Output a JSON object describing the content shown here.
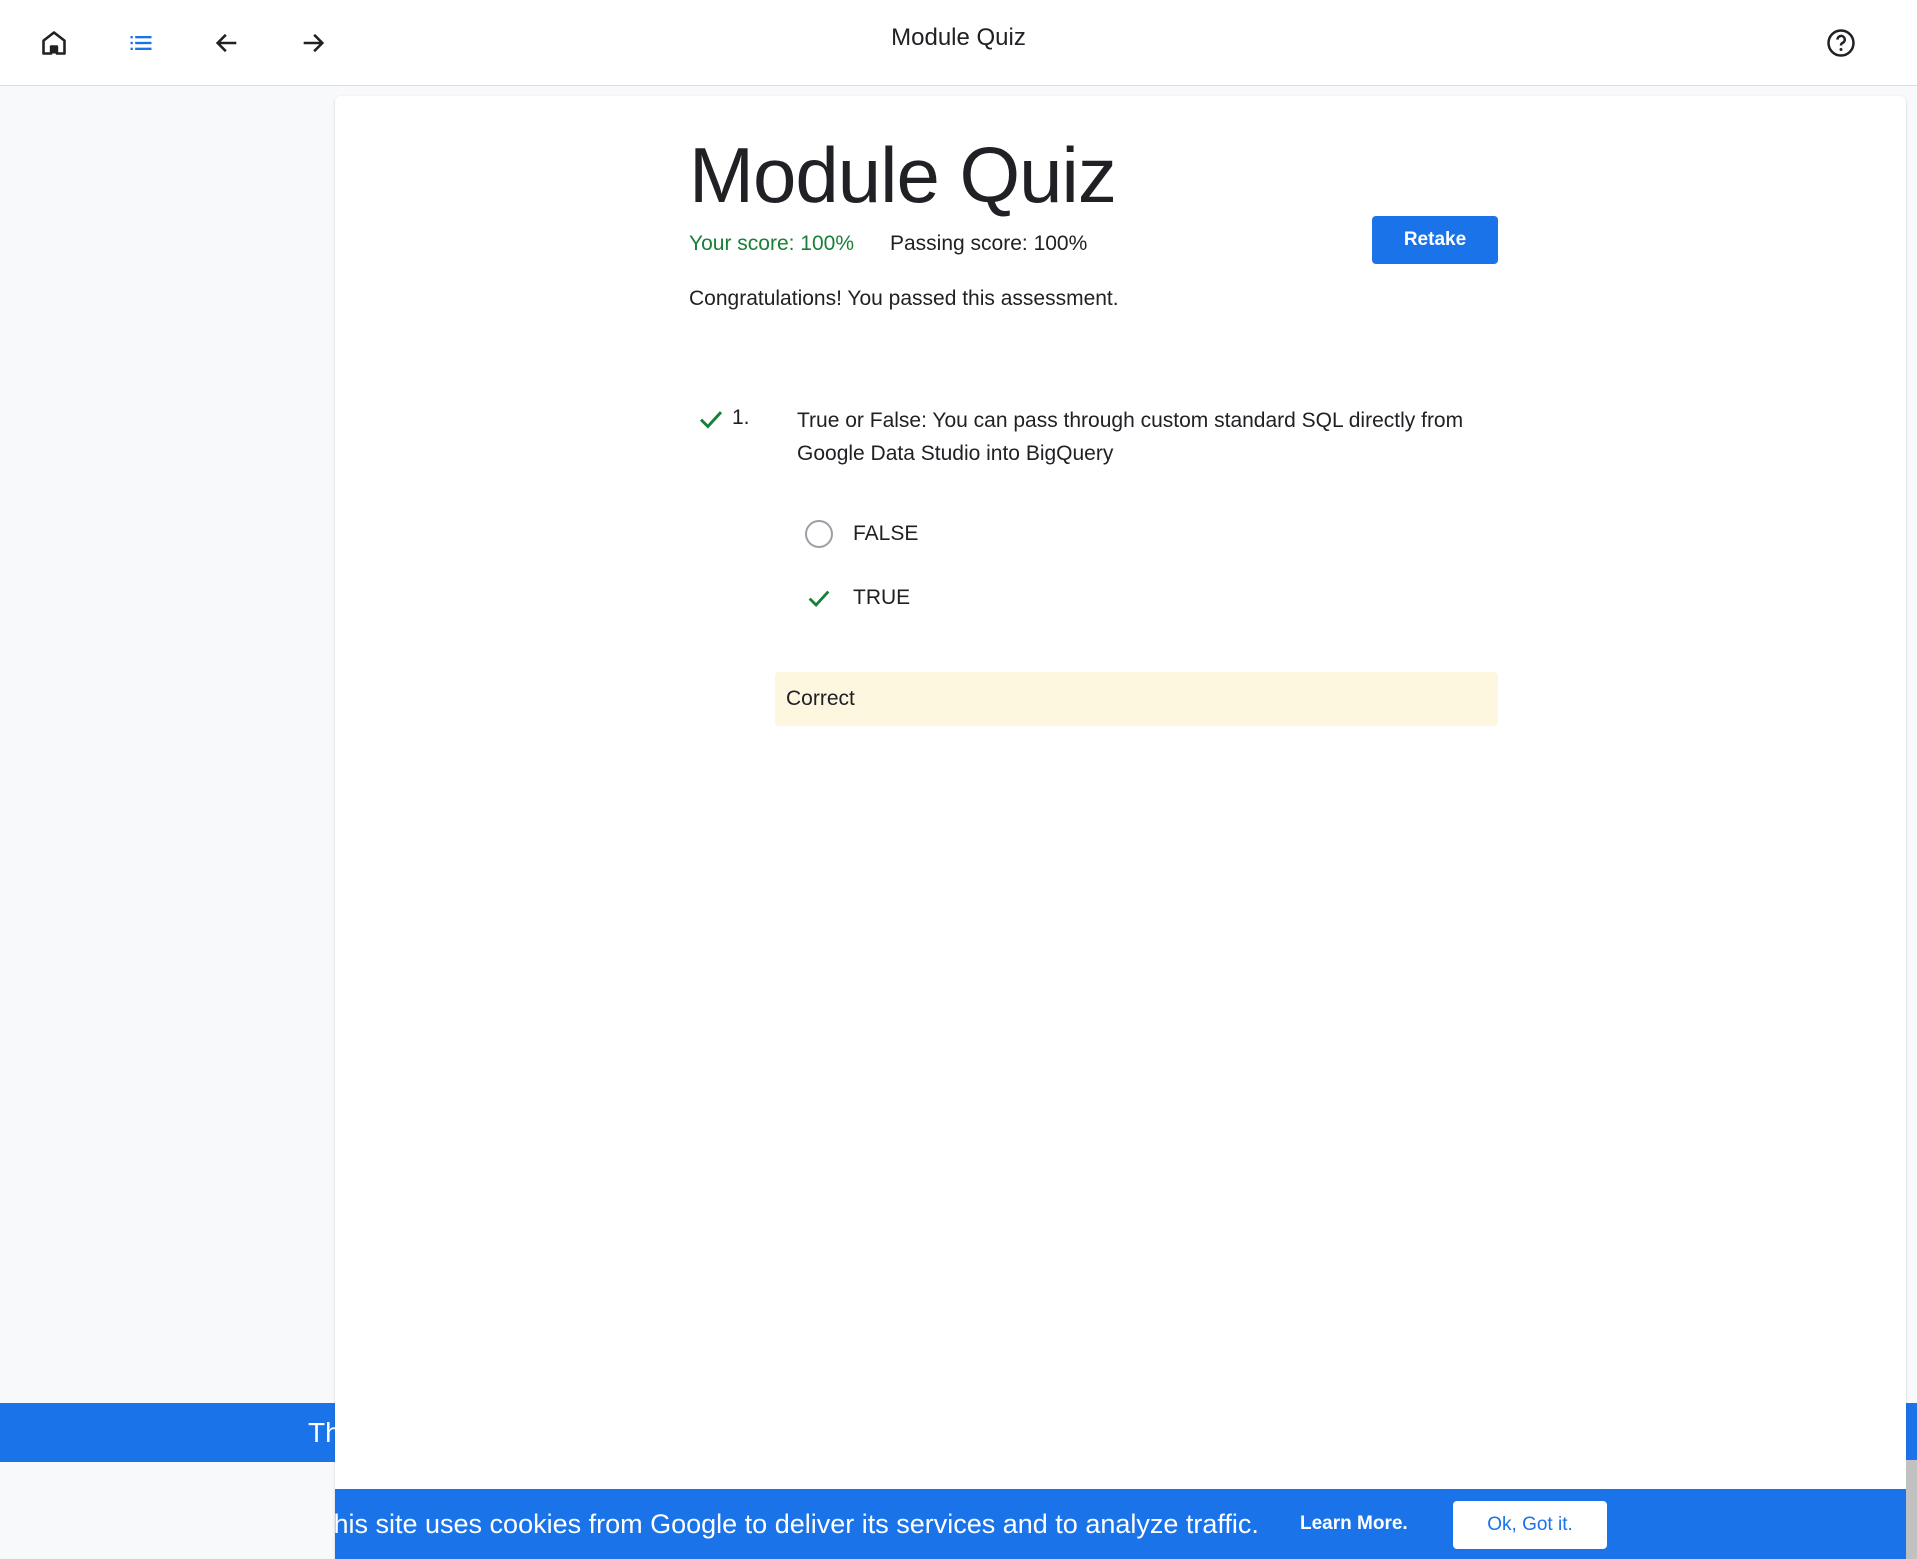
{
  "topbar": {
    "title": "Module Quiz",
    "icons": [
      "home-icon",
      "list-icon",
      "arrow-back-icon",
      "arrow-forward-icon",
      "help-icon"
    ]
  },
  "quiz": {
    "title": "Module Quiz",
    "your_score": "Your score: 100%",
    "passing_score": "Passing score: 100%",
    "retake_label": "Retake",
    "result_message": "Congratulations! You passed this assessment.",
    "questions": [
      {
        "number": "1.",
        "text": "True or False: You can pass through custom standard SQL directly from Google Data Studio into BigQuery",
        "options": [
          {
            "label": "FALSE",
            "selected": false
          },
          {
            "label": "TRUE",
            "selected": true
          }
        ],
        "feedback": "Correct"
      }
    ]
  },
  "banner": {
    "text": "This site uses cookies from Google to deliver its services and to analyze traffic."
  },
  "cookie": {
    "text": "This site uses cookies from Google to deliver its services and to analyze traffic.",
    "learn_more": "Learn More.",
    "ok_label": "Ok, Got it."
  },
  "colors": {
    "accent": "#1a73e8",
    "success": "#188038",
    "feedback_bg": "#fef7e0"
  }
}
